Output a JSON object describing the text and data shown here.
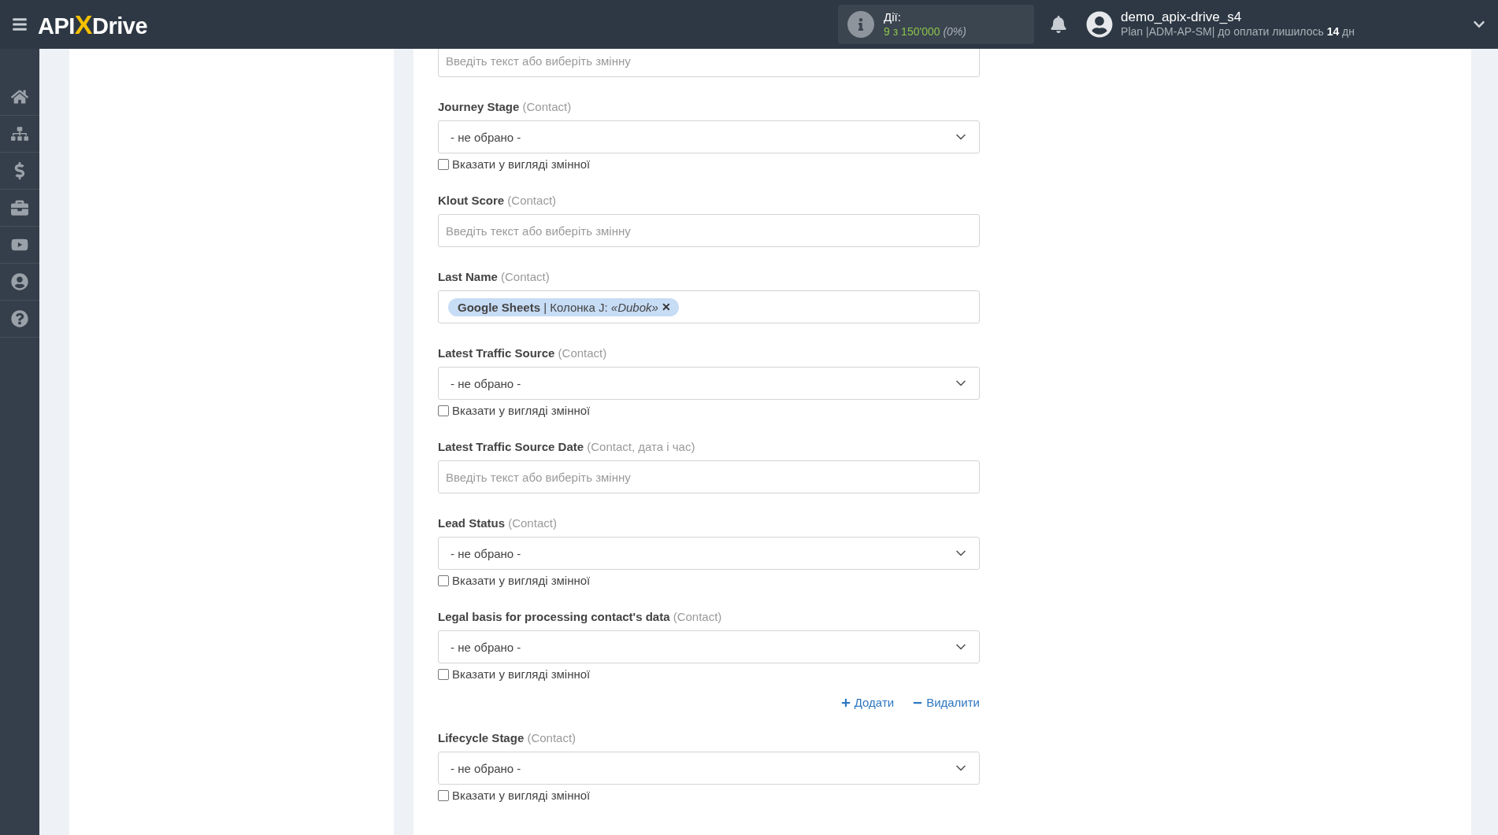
{
  "header": {
    "logo": [
      "API",
      "X",
      "Drive"
    ],
    "actions": {
      "label": "Дії:",
      "value": "9 з 150'000",
      "percent": "(0%)"
    },
    "user": {
      "name": "demo_apix-drive_s4",
      "plan": "Plan |ADM-AP-SM| до оплати лишилось **14** дн"
    }
  },
  "fields": [
    {
      "kind": "text",
      "placeholder": "Введіть текст або виберіть змінну"
    },
    {
      "kind": "select",
      "label": "Journey Stage",
      "hint": "(Contact)",
      "value": "- не обрано -",
      "variable_label": "Вказати у вигляді змінної",
      "checked": false
    },
    {
      "kind": "text",
      "label": "Klout Score",
      "hint": "(Contact)",
      "placeholder": "Введіть текст або виберіть змінну"
    },
    {
      "kind": "tags",
      "label": "Last Name",
      "hint": "(Contact)",
      "tags": [
        {
          "source": "Google Sheets",
          "column": "| Колонка J:",
          "value": "«Dubok»",
          "remove": "✕"
        }
      ]
    },
    {
      "kind": "select",
      "label": "Latest Traffic Source",
      "hint": "(Contact)",
      "value": "- не обрано -",
      "variable_label": "Вказати у вигляді змінної",
      "checked": false
    },
    {
      "kind": "text",
      "label": "Latest Traffic Source Date",
      "hint": "(Contact, дата і час)",
      "placeholder": "Введіть текст або виберіть змінну"
    },
    {
      "kind": "select",
      "label": "Lead Status",
      "hint": "(Contact)",
      "value": "- не обрано -",
      "variable_label": "Вказати у вигляді змінної",
      "checked": false
    },
    {
      "kind": "select",
      "label": "Legal basis for processing contact's data",
      "hint": "(Contact)",
      "value": "- не обрано -",
      "variable_label": "Вказати у вигляді змінної",
      "checked": false
    },
    {
      "kind": "actions",
      "add": "Додати",
      "remove": "Видалити"
    },
    {
      "kind": "select",
      "label": "Lifecycle Stage",
      "hint": "(Contact)",
      "value": "- не обрано -",
      "variable_label": "Вказати у вигляді змінної",
      "checked": false
    }
  ]
}
